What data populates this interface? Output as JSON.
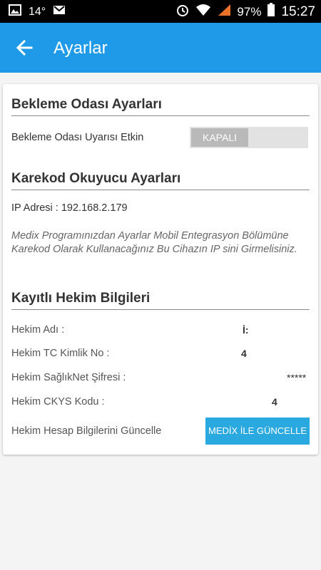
{
  "status_bar": {
    "temperature": "14°",
    "battery": "97%",
    "time": "15:27",
    "icons": [
      "image-icon",
      "gmail-icon",
      "alarm-icon",
      "wifi-icon",
      "signal-icon",
      "battery-icon"
    ]
  },
  "app_bar": {
    "title": "Ayarlar"
  },
  "waiting_room": {
    "title": "Bekleme Odası Ayarları",
    "alert_label": "Bekleme Odası Uyarısı Etkin",
    "toggle_state": "KAPALI"
  },
  "qr_reader": {
    "title": "Karekod Okuyucu Ayarları",
    "ip_line": "IP Adresi : 192.168.2.179",
    "info": "Medix Programınızdan Ayarlar Mobil Entegrasyon Bölümüne Karekod Olarak Kullanacağınız Bu Cihazın IP sini Girmelisiniz."
  },
  "doctor": {
    "title": "Kayıtlı Hekim Bilgileri",
    "name_label": "Hekim Adı :",
    "name_value": "İ:",
    "tc_label": "Hekim TC Kimlik No :",
    "tc_value": "4",
    "password_label": "Hekim SağlıkNet Şifresi :",
    "password_value": "*****",
    "ckys_label": "Hekim CKYS Kodu :",
    "ckys_value": "4",
    "update_label": "Hekim Hesap Bilgilerini Güncelle",
    "update_button": "MEDİX İLE GÜNCELLE"
  },
  "colors": {
    "app_bar": "#1e9ae8",
    "button": "#2aa9e0"
  }
}
